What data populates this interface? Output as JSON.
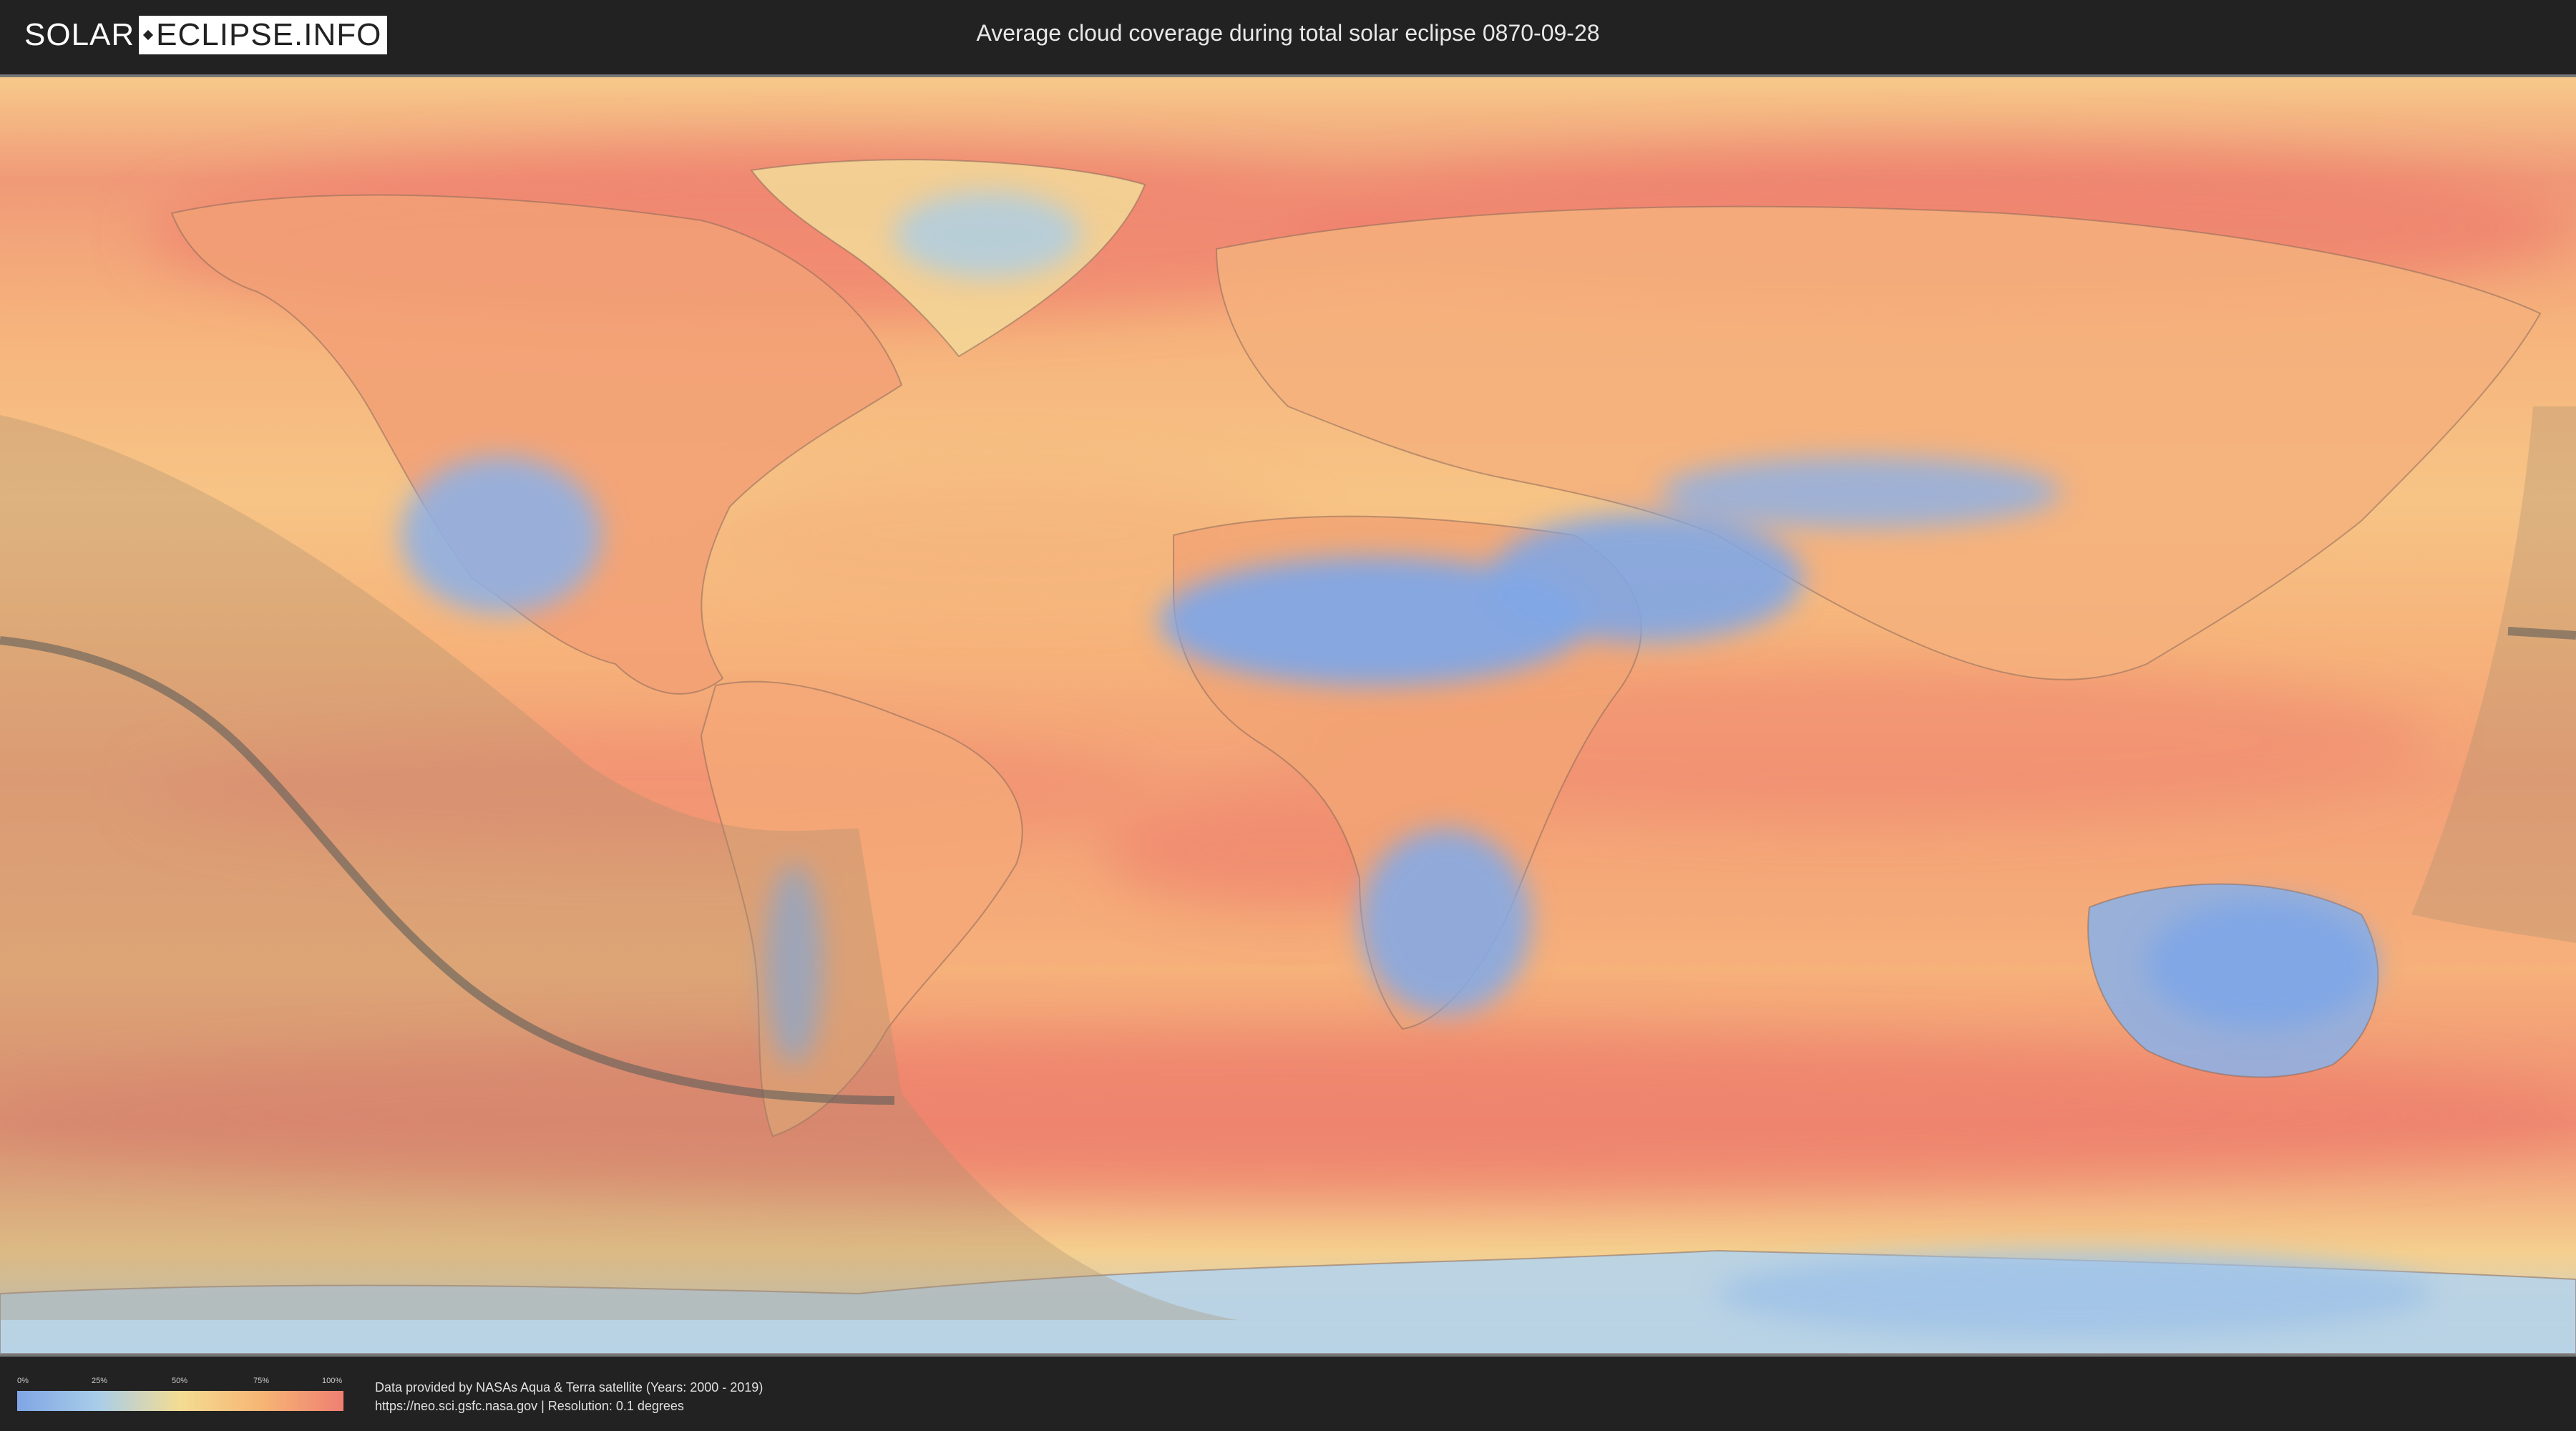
{
  "header": {
    "logo_left": "SOLAR",
    "logo_right": "ECLIPSE.INFO",
    "title": "Average cloud coverage during total solar eclipse 0870-09-28"
  },
  "legend": {
    "ticks": [
      "0%",
      "25%",
      "50%",
      "75%",
      "100%"
    ],
    "colors": [
      "#7fa6e6",
      "#a9cde8",
      "#f4dc92",
      "#f6b574",
      "#ef7f72"
    ]
  },
  "credits": {
    "line1": "Data provided by NASAs Aqua & Terra satellite (Years: 2000 - 2019)",
    "line2": "https://neo.sci.gsfc.nasa.gov | Resolution: 0.1 degrees"
  },
  "map": {
    "colors": {
      "ocean_cloudy": "#f08c72",
      "ocean_mid": "#f6b67a",
      "clear": "#8fb0e3",
      "land_outline": "#8a6a5a",
      "shadow": "#a89070",
      "centerline": "#5e5e58"
    }
  }
}
